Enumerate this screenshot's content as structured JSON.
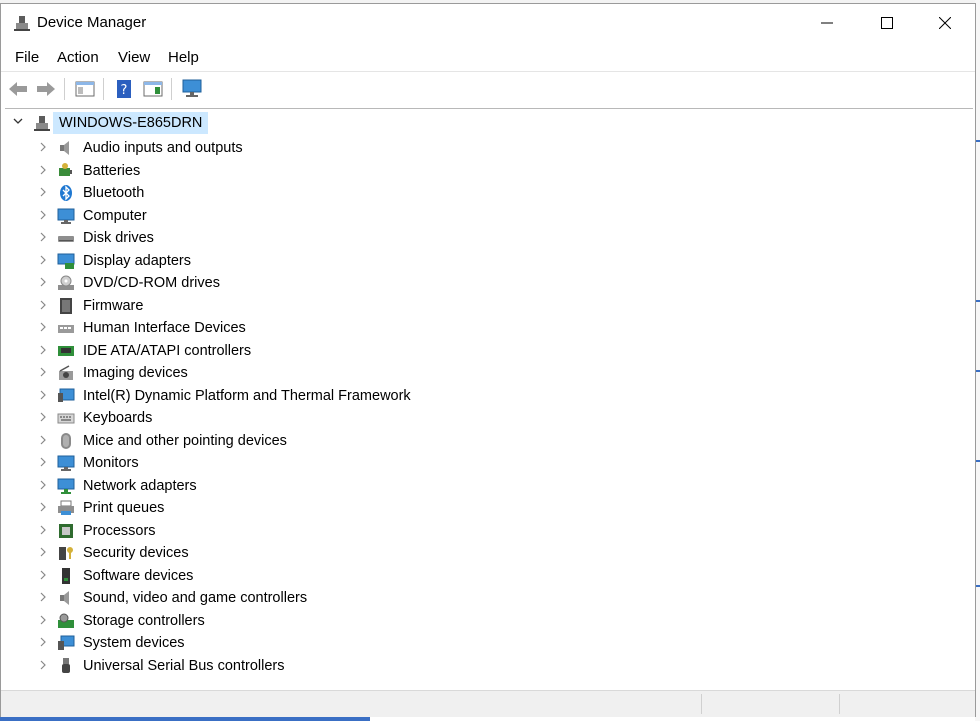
{
  "window": {
    "title": "Device Manager"
  },
  "menu": [
    "File",
    "Action",
    "View",
    "Help"
  ],
  "toolbar": {
    "buttons": [
      "back-icon",
      "forward-icon",
      "properties-icon",
      "help-icon",
      "show-hide-console-tree-icon",
      "scan-hardware-icon"
    ]
  },
  "tree": {
    "root": "WINDOWS-E865DRN",
    "items": [
      {
        "label": "Audio inputs and outputs",
        "icon": "speaker-icon"
      },
      {
        "label": "Batteries",
        "icon": "battery-icon"
      },
      {
        "label": "Bluetooth",
        "icon": "bluetooth-icon"
      },
      {
        "label": "Computer",
        "icon": "computer-icon"
      },
      {
        "label": "Disk drives",
        "icon": "disk-drive-icon"
      },
      {
        "label": "Display adapters",
        "icon": "display-adapter-icon"
      },
      {
        "label": "DVD/CD-ROM drives",
        "icon": "dvd-icon"
      },
      {
        "label": "Firmware",
        "icon": "firmware-icon"
      },
      {
        "label": "Human Interface Devices",
        "icon": "hid-icon"
      },
      {
        "label": "IDE ATA/ATAPI controllers",
        "icon": "ide-controller-icon"
      },
      {
        "label": "Imaging devices",
        "icon": "camera-icon"
      },
      {
        "label": "Intel(R) Dynamic Platform and Thermal Framework",
        "icon": "chip-monitor-icon"
      },
      {
        "label": "Keyboards",
        "icon": "keyboard-icon"
      },
      {
        "label": "Mice and other pointing devices",
        "icon": "mouse-icon"
      },
      {
        "label": "Monitors",
        "icon": "monitor-icon"
      },
      {
        "label": "Network adapters",
        "icon": "network-icon"
      },
      {
        "label": "Print queues",
        "icon": "printer-icon"
      },
      {
        "label": "Processors",
        "icon": "processor-icon"
      },
      {
        "label": "Security devices",
        "icon": "security-key-icon"
      },
      {
        "label": "Software devices",
        "icon": "software-device-icon"
      },
      {
        "label": "Sound, video and game controllers",
        "icon": "speaker-icon"
      },
      {
        "label": "Storage controllers",
        "icon": "storage-controller-icon"
      },
      {
        "label": "System devices",
        "icon": "system-devices-icon"
      },
      {
        "label": "Universal Serial Bus controllers",
        "icon": "usb-icon"
      }
    ]
  },
  "colors": {
    "selection": "#cce8ff",
    "accent": "#3a6fc4"
  }
}
